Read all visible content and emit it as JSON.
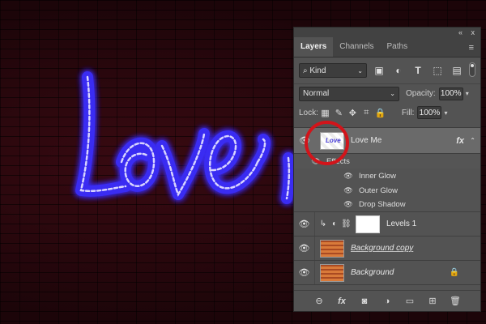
{
  "panel": {
    "collapse_glyph": "«",
    "close_glyph": "x",
    "tabs": [
      {
        "label": "Layers",
        "active": true
      },
      {
        "label": "Channels",
        "active": false
      },
      {
        "label": "Paths",
        "active": false
      }
    ],
    "menu_icon": "menu-icon"
  },
  "filter": {
    "kind_label": "Kind",
    "search_glyph": "⌕",
    "chevron": "⌄",
    "icons": [
      "image-filter-icon",
      "adjustment-filter-icon",
      "type-filter-icon",
      "shape-filter-icon",
      "smart-object-filter-icon"
    ]
  },
  "blend": {
    "mode": "Normal",
    "opacity_label": "Opacity:",
    "opacity_value": "100%",
    "fill_label": "Fill:",
    "fill_value": "100%"
  },
  "lock": {
    "label": "Lock:"
  },
  "layers": {
    "love": {
      "name": "Love Me",
      "thumb_text": "Love",
      "fx": "fx"
    },
    "effects_label": "Effects",
    "effects": [
      "Inner Glow",
      "Outer Glow",
      "Drop Shadow"
    ],
    "levels": {
      "name": "Levels 1"
    },
    "bg_copy": {
      "name": "Background copy"
    },
    "bg": {
      "name": "Background"
    }
  },
  "colors": {
    "neon": "#5a4cff",
    "highlight": "#d2141a",
    "panel_bg": "#535353"
  }
}
